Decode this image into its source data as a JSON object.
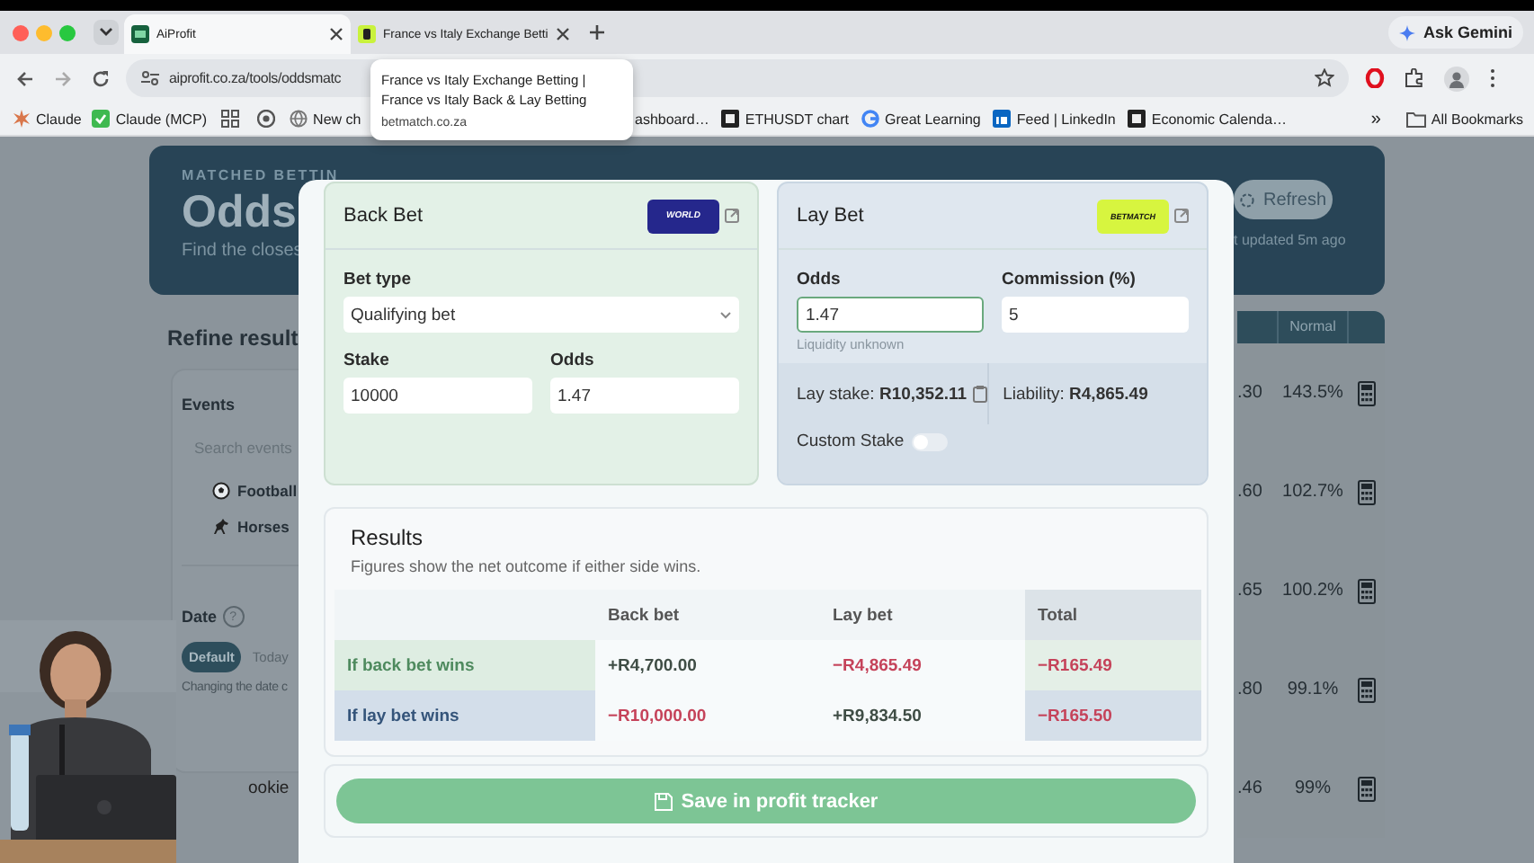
{
  "browser": {
    "tabs": [
      {
        "title": "AiProfit",
        "selected": true
      },
      {
        "title": "France vs Italy Exchange Betti",
        "selected": false
      }
    ],
    "ask_button": "Ask Gemini",
    "url": "aiprofit.co.za/tools/oddsmatc",
    "bookmarks_left": [
      {
        "kind": "spark",
        "label": "Claude"
      },
      {
        "kind": "check",
        "label": "Claude (MCP)"
      },
      {
        "kind": "grid"
      },
      {
        "kind": "chrome"
      },
      {
        "kind": "globe",
        "label": "New ch"
      }
    ],
    "bookmarks_right": [
      {
        "kind": "plain",
        "label": "ashboard…"
      },
      {
        "kind": "square",
        "label": "ETHUSDT chart"
      },
      {
        "kind": "letter",
        "label": "Great Learning"
      },
      {
        "kind": "linked",
        "label": "Feed | LinkedIn"
      },
      {
        "kind": "square",
        "label": "Economic Calenda…"
      }
    ],
    "more_bookmarks": "»",
    "all_bookmarks": "All Bookmarks",
    "tooltip": {
      "title": "France vs Italy Exchange Betting | France vs Italy Back & Lay Betting",
      "domain": "betmatch.co.za"
    }
  },
  "page": {
    "header": {
      "eyebrow": "MATCHED BETTIN",
      "title": "Odds",
      "subtitle": "Find the closes",
      "refresh_button": "Refresh",
      "updated": "t updated 5m ago"
    },
    "filters": {
      "title": "Refine result",
      "events_label": "Events",
      "search_placeholder": "Search events",
      "sports": [
        {
          "kind": "football",
          "label": "Football"
        },
        {
          "kind": "horse",
          "label": "Horses"
        }
      ],
      "date_label": "Date",
      "date_help": "?",
      "date_options": [
        {
          "label": "Default",
          "selected": true
        },
        {
          "label": "Today",
          "selected": false
        }
      ],
      "date_note": "Changing the date c",
      "bookies_label": "ookie"
    },
    "table": {
      "columns": [
        "Normal"
      ],
      "rows": [
        {
          "odds": ".30",
          "normal": "143.5%"
        },
        {
          "odds": ".60",
          "normal": "102.7%"
        },
        {
          "odds": ".65",
          "normal": "100.2%"
        },
        {
          "odds": ".80",
          "normal": "99.1%"
        },
        {
          "odds": ".46",
          "normal": "99%"
        }
      ]
    }
  },
  "modal": {
    "back": {
      "title": "Back Bet",
      "logo_text": "WORLD",
      "bet_type_label": "Bet type",
      "bet_type": "Qualifying bet",
      "stake_label": "Stake",
      "stake": "10000",
      "odds_label": "Odds",
      "odds": "1.47"
    },
    "lay": {
      "title": "Lay Bet",
      "logo_text": "BETMATCH",
      "odds_label": "Odds",
      "odds": "1.47",
      "odds_focused": true,
      "commission_label": "Commission (%)",
      "commission": "5",
      "liquidity": "Liquidity unknown",
      "lay_stake": "Lay stake: **R10,352.11**",
      "liability": "Liability: **R4,865.49**",
      "custom_stake_label": "Custom Stake",
      "custom_stake_on": false
    },
    "results": {
      "title": "Results",
      "subtitle": "Figures show the net outcome if either side wins.",
      "columns": [
        "Back bet",
        "Lay bet",
        "Total"
      ],
      "rows": [
        {
          "kind": "back",
          "label": "If back bet wins",
          "cells": [
            {
              "value": "+R4,700.00",
              "kind": "gain"
            },
            {
              "value": "−R4,865.49",
              "kind": "loss"
            },
            {
              "value": "−R165.49",
              "kind": "loss"
            }
          ]
        },
        {
          "kind": "lay",
          "label": "If lay bet wins",
          "cells": [
            {
              "value": "−R10,000.00",
              "kind": "loss"
            },
            {
              "value": "+R9,834.50",
              "kind": "gain"
            },
            {
              "value": "−R165.50",
              "kind": "loss"
            }
          ]
        }
      ]
    },
    "save_button": "Save in profit tracker"
  }
}
